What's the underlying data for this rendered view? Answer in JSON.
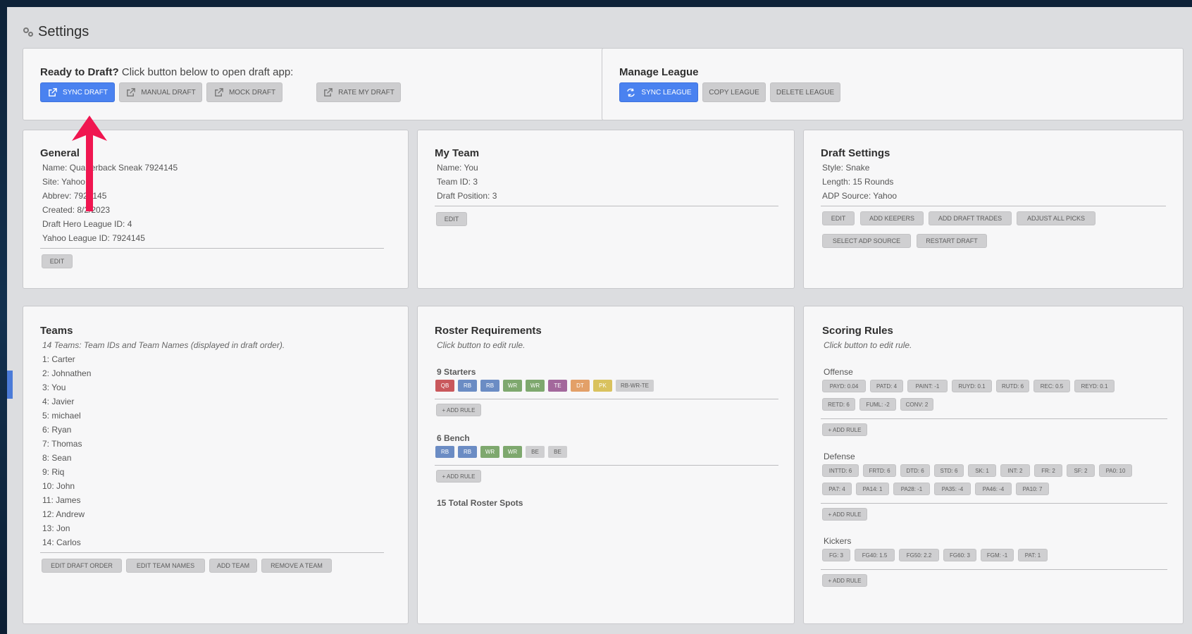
{
  "page": {
    "title": "Settings",
    "title_icon": "gears-icon"
  },
  "ready": {
    "heading_bold": "Ready to Draft?",
    "heading_text": " Click button below to open draft app:",
    "buttons": {
      "sync_draft": "SYNC DRAFT",
      "manual_draft": "MANUAL DRAFT",
      "mock_draft": "MOCK DRAFT",
      "rate_my_draft": "RATE MY DRAFT"
    }
  },
  "manage": {
    "heading": "Manage League",
    "buttons": {
      "sync_league": "SYNC LEAGUE",
      "copy_league": "COPY LEAGUE",
      "delete_league": "DELETE LEAGUE"
    }
  },
  "general": {
    "heading": "General",
    "lines": [
      "Name: Quarterback Sneak 7924145",
      "Site: Yahoo",
      "Abbrev: 7924145",
      "Created: 8/2/2023",
      "Draft Hero League ID: 4",
      "Yahoo League ID: 7924145"
    ],
    "edit": "EDIT"
  },
  "my_team": {
    "heading": "My Team",
    "lines": [
      "Name: You",
      "Team ID: 3",
      "Draft Position: 3"
    ],
    "edit": "EDIT"
  },
  "draft_settings": {
    "heading": "Draft Settings",
    "lines": [
      "Style: Snake",
      "Length: 15 Rounds",
      "ADP Source: Yahoo"
    ],
    "buttons": {
      "edit": "EDIT",
      "add_keepers": "ADD KEEPERS",
      "add_draft_trades": "ADD DRAFT TRADES",
      "adjust_all_picks": "ADJUST ALL PICKS",
      "select_adp_source": "SELECT ADP SOURCE",
      "restart_draft": "RESTART DRAFT"
    }
  },
  "teams": {
    "heading": "Teams",
    "note": "14 Teams: Team IDs and Team Names (displayed in draft order).",
    "list": [
      "1: Carter",
      "2: Johnathen",
      "3: You",
      "4: Javier",
      "5: michael",
      "6: Ryan",
      "7: Thomas",
      "8: Sean",
      "9: Riq",
      "10: John",
      "11: James",
      "12: Andrew",
      "13: Jon",
      "14: Carlos"
    ],
    "buttons": {
      "edit_draft_order": "EDIT DRAFT ORDER",
      "edit_team_names": "EDIT TEAM NAMES",
      "add_team": "ADD TEAM",
      "remove_team": "REMOVE A TEAM"
    }
  },
  "roster": {
    "heading": "Roster Requirements",
    "note": "Click button to edit rule.",
    "starters_label": "9 Starters",
    "starters": [
      {
        "label": "QB",
        "color": "#c9585c"
      },
      {
        "label": "RB",
        "color": "#6b8cc4"
      },
      {
        "label": "RB",
        "color": "#6b8cc4"
      },
      {
        "label": "WR",
        "color": "#7ea86e"
      },
      {
        "label": "WR",
        "color": "#7ea86e"
      },
      {
        "label": "TE",
        "color": "#a3689c"
      },
      {
        "label": "DT",
        "color": "#e3a068"
      },
      {
        "label": "PK",
        "color": "#d9c25e"
      },
      {
        "label": "RB-WR-TE",
        "color": "#cfcfd1"
      }
    ],
    "bench_label": "6 Bench",
    "bench": [
      {
        "label": "RB",
        "color": "#6b8cc4"
      },
      {
        "label": "RB",
        "color": "#6b8cc4"
      },
      {
        "label": "WR",
        "color": "#7ea86e"
      },
      {
        "label": "WR",
        "color": "#7ea86e"
      },
      {
        "label": "BE",
        "color": "#cfcfd1"
      },
      {
        "label": "BE",
        "color": "#cfcfd1"
      }
    ],
    "add_rule": "+ ADD RULE",
    "total": "15 Total Roster Spots"
  },
  "scoring": {
    "heading": "Scoring Rules",
    "note": "Click button to edit rule.",
    "add_rule": "+ ADD RULE",
    "offense_label": "Offense",
    "offense": [
      "PAYD: 0.04",
      "PATD: 4",
      "PAINT: -1",
      "RUYD: 0.1",
      "RUTD: 6",
      "REC: 0.5",
      "REYD: 0.1",
      "RETD: 6",
      "FUML: -2",
      "CONV: 2"
    ],
    "defense_label": "Defense",
    "defense": [
      "INTTD: 6",
      "FRTD: 6",
      "DTD: 6",
      "STD: 6",
      "SK: 1",
      "INT: 2",
      "FR: 2",
      "SF: 2",
      "PA0: 10",
      "PA7: 4",
      "PA14: 1",
      "PA28: -1",
      "PA35: -4",
      "PA46: -4",
      "PA10: 7"
    ],
    "kickers_label": "Kickers",
    "kickers": [
      "FG: 3",
      "FG40: 1.5",
      "FG50: 2.2",
      "FG60: 3",
      "FGM: -1",
      "PAT: 1"
    ]
  },
  "colors": {
    "accent": "#4a82f0",
    "annotation_arrow": "#f01650"
  }
}
